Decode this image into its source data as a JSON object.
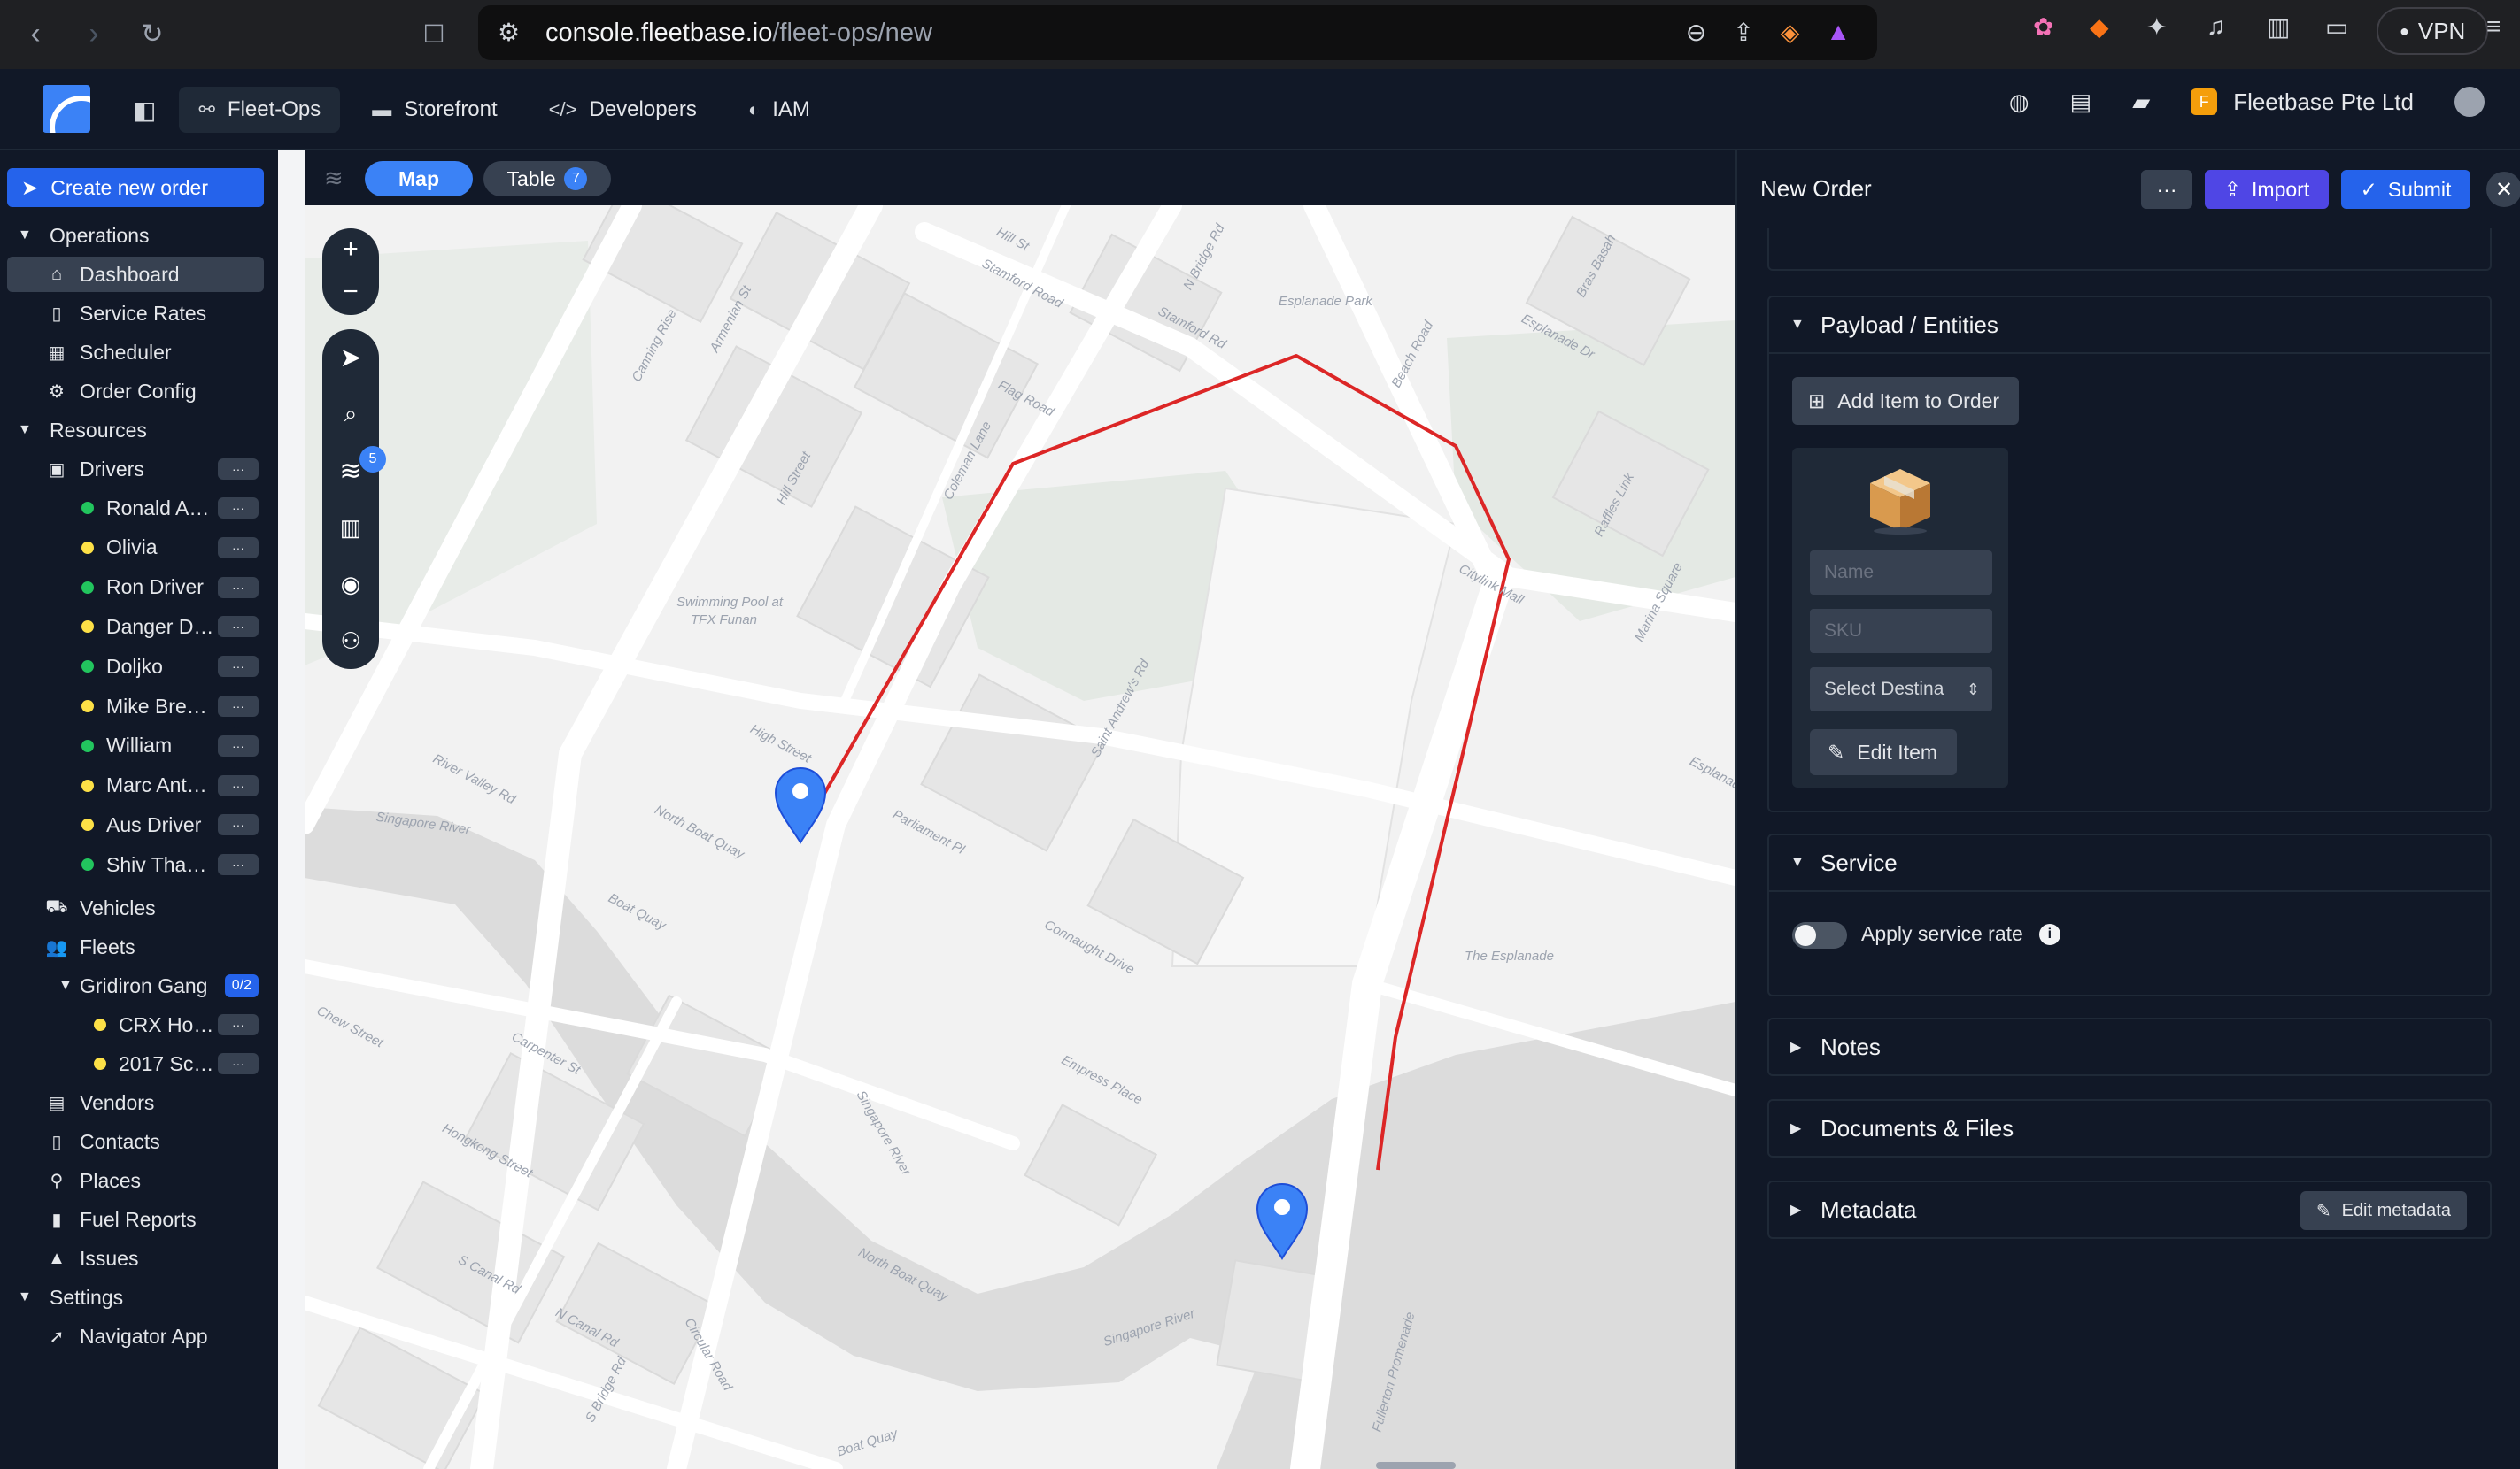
{
  "browser": {
    "url_host": "console.fleetbase.io",
    "url_path": "/fleet-ops/new",
    "vpn_label": "VPN"
  },
  "header": {
    "tabs": [
      {
        "label": "Fleet-Ops",
        "icon": "route-icon"
      },
      {
        "label": "Storefront",
        "icon": "store-icon"
      },
      {
        "label": "Developers",
        "icon": "code-icon"
      },
      {
        "label": "IAM",
        "icon": "shield-icon"
      }
    ],
    "org_initial": "F",
    "org_name": "Fleetbase Pte Ltd"
  },
  "sidebar": {
    "create_label": "Create new order",
    "sections": {
      "operations": "Operations",
      "resources": "Resources",
      "settings": "Settings"
    },
    "operations_items": [
      "Dashboard",
      "Service Rates",
      "Scheduler",
      "Order Config"
    ],
    "drivers_label": "Drivers",
    "drivers": [
      {
        "name": "Ronald A…",
        "status": "online"
      },
      {
        "name": "Olivia",
        "status": "away"
      },
      {
        "name": "Ron Driver",
        "status": "online"
      },
      {
        "name": "Danger D…",
        "status": "away"
      },
      {
        "name": "Doljko",
        "status": "online"
      },
      {
        "name": "Mike Bre…",
        "status": "away"
      },
      {
        "name": "William",
        "status": "online"
      },
      {
        "name": "Marc Ant…",
        "status": "away"
      },
      {
        "name": "Aus Driver",
        "status": "away"
      },
      {
        "name": "Shiv Tha…",
        "status": "online"
      }
    ],
    "vehicles_label": "Vehicles",
    "fleets_label": "Fleets",
    "fleet_name": "Gridiron Gang",
    "fleet_count": "0/2",
    "fleet_vehicles": [
      "CRX Ho…",
      "2017 Sc…"
    ],
    "resource_items": [
      "Vendors",
      "Contacts",
      "Places",
      "Fuel Reports",
      "Issues"
    ],
    "settings_items": [
      "Navigator App"
    ],
    "status_colors": {
      "online": "#22c55e",
      "away": "#fde047"
    }
  },
  "map": {
    "view_map_label": "Map",
    "view_table_label": "Table",
    "table_count": "7",
    "layers_count": "5",
    "route_color": "#dc2626",
    "pin_color": "#3b82f6",
    "street_labels": [
      "Hill Street",
      "Stamford Road",
      "N Bridge Rd",
      "Coleman Lane",
      "Flag Road",
      "Esplanade Park",
      "Beach Road",
      "Swimming Pool at",
      "TFX Funan",
      "River Valley Rd",
      "Singapore River",
      "North Boat Quay",
      "Boat Quay",
      "Parliament Pl",
      "Saint Andrew's Rd",
      "Connaught Drive",
      "High Street",
      "The Esplanade",
      "Citylink Mall",
      "Empress Place",
      "Singapore River",
      "North Boat Quay",
      "Singapore River",
      "S Canal Rd",
      "N Canal Rd",
      "Chew Street",
      "Carpenter St",
      "Hongkong Street",
      "Circular Road",
      "S Bridge Rd",
      "Fullerton Promenade",
      "Boat Quay",
      "Esplanade Dr",
      "Bras Basah",
      "Raffles Link",
      "Marina Square",
      "Esplanade Dr",
      "Stamford Rd",
      "Canning Rise",
      "Armenian St",
      "Hill St"
    ]
  },
  "order_panel": {
    "title": "New Order",
    "more_label": "···",
    "import_label": "Import",
    "submit_label": "Submit",
    "payload": {
      "title": "Payload / Entities",
      "add_item_label": "Add Item to Order",
      "name_placeholder": "Name",
      "sku_placeholder": "SKU",
      "destination_label": "Select Destina",
      "edit_item_label": "Edit Item"
    },
    "service": {
      "title": "Service",
      "apply_rate_label": "Apply service rate"
    },
    "notes_title": "Notes",
    "documents_title": "Documents & Files",
    "metadata_title": "Metadata",
    "edit_metadata_label": "Edit metadata"
  }
}
